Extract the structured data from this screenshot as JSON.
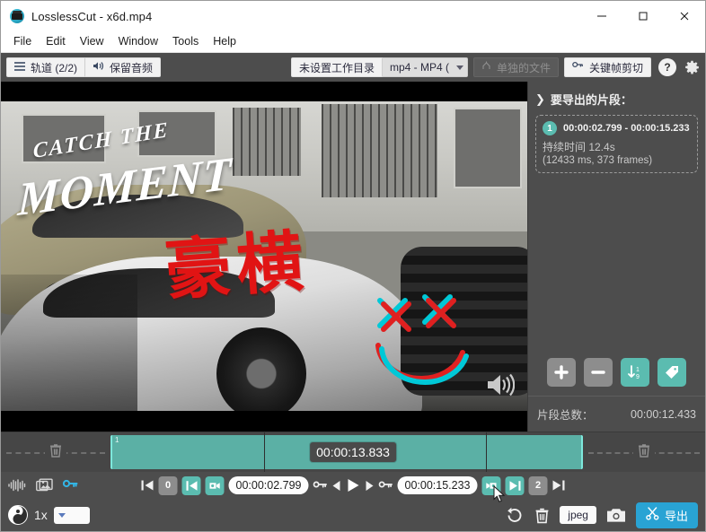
{
  "window": {
    "title": "LosslessCut - x6d.mp4",
    "app_icon": "film-camera-icon",
    "minimize_label": "–",
    "maximize_label": "□",
    "close_label": "×"
  },
  "menubar": {
    "items": [
      {
        "label": "File"
      },
      {
        "label": "Edit"
      },
      {
        "label": "View"
      },
      {
        "label": "Window"
      },
      {
        "label": "Tools"
      },
      {
        "label": "Help"
      }
    ]
  },
  "toolbar": {
    "tracks_label": "轨道 (2/2)",
    "keep_audio_label": "保留音频",
    "working_dir_label": "未设置工作目录",
    "format_label": "mp4 - MP4 (",
    "merge_label": "单独的文件",
    "keyframe_cut_label": "关键帧剪切",
    "help_label": "?",
    "settings_icon": "gear-icon"
  },
  "player": {
    "overlay_catch": "CATCH THE",
    "overlay_moment": "MOMENT",
    "overlay_chinese": "豪横",
    "volume_icon": "volume-on-icon"
  },
  "right_panel": {
    "header": "要导出的片段：",
    "segments": [
      {
        "number": "1",
        "range": "00:00:02.799 - 00:00:15.233",
        "duration": "持续时间 12.4s",
        "frames": "(12433 ms, 373 frames)"
      }
    ],
    "actions": [
      {
        "name": "add-segment-button",
        "icon": "plus-icon",
        "accent": false
      },
      {
        "name": "remove-segment-button",
        "icon": "minus-icon",
        "accent": false
      },
      {
        "name": "sort-segments-button",
        "icon": "sort-numeric-icon",
        "accent": true
      },
      {
        "name": "label-segment-button",
        "icon": "tag-icon",
        "accent": true
      }
    ],
    "total_label": "片段总数：",
    "total_value": "00:00:12.433"
  },
  "timeline": {
    "current_time": "00:00:13.833",
    "segment_number": "1",
    "left_trash_icon": "trash-icon",
    "right_trash_icon": "trash-icon"
  },
  "controls": {
    "waveform_icon": "waveform-icon",
    "thumbnails_icon": "thumbnails-icon",
    "keyframes_icon": "key-icon",
    "jump_start_icon": "jump-to-start-icon",
    "seg_index_left": "0",
    "set_cut_start_icon": "set-cut-start-icon",
    "cut_start_marker_icon": "cut-start-marker-icon",
    "cut_start_time": "00:00:02.799",
    "key_left_icon": "key-icon",
    "prev_frame_icon": "previous-frame-icon",
    "play_icon": "play-icon",
    "next_frame_icon": "next-frame-icon",
    "key_right_icon": "key-icon",
    "cut_end_time": "00:00:15.233",
    "cut_end_marker_icon": "cut-end-marker-icon",
    "set_cut_end_icon": "set-cut-end-icon",
    "seg_index_right": "2",
    "jump_end_icon": "jump-to-end-icon",
    "speed_icon": "yin-yang-icon",
    "speed_label": "1x",
    "rotate_icon": "rotate-icon",
    "delete_icon": "trash-icon",
    "capture_format": "jpeg",
    "camera_icon": "camera-icon",
    "export_label": "导出",
    "export_icon": "scissors-icon"
  },
  "colors": {
    "accent_teal": "#5bbcb0",
    "segment_teal": "#5bb0a5",
    "export_blue": "#29a3d4",
    "panel_bg": "#4d4d4d",
    "key_blue": "#33b5e5"
  }
}
